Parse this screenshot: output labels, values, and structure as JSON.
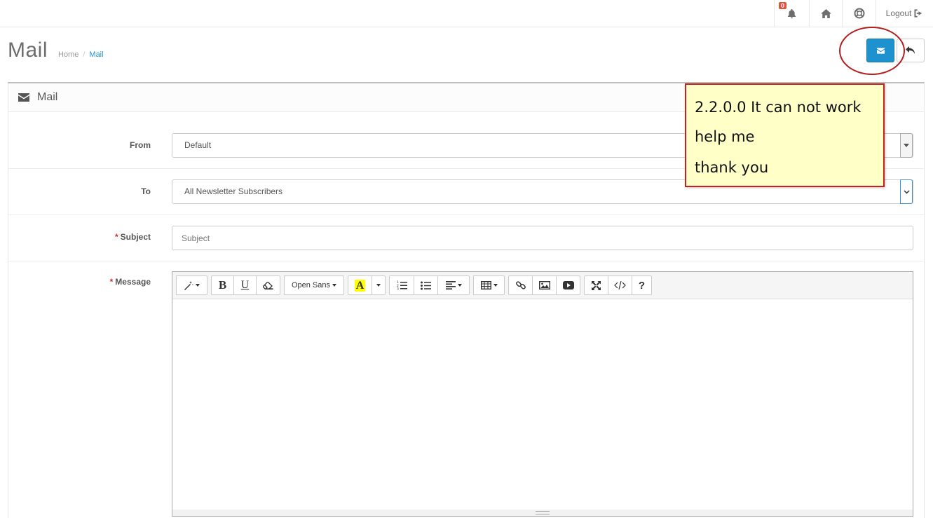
{
  "header": {
    "notification_count": "0",
    "logout_label": "Logout"
  },
  "page": {
    "title": "Mail",
    "breadcrumb": [
      "Home",
      "Mail"
    ]
  },
  "panel": {
    "title": "Mail"
  },
  "form": {
    "from": {
      "label": "From",
      "value": "Default"
    },
    "to": {
      "label": "To",
      "value": "All Newsletter Subscribers"
    },
    "subject": {
      "label": "Subject",
      "placeholder": "Subject",
      "value": ""
    },
    "message": {
      "label": "Message"
    }
  },
  "editor_toolbar": {
    "font_name": "Open Sans",
    "font_color_letter": "A",
    "bold": "B",
    "underline": "U",
    "help": "?"
  },
  "note": {
    "lines": [
      "2.2.0.0 It can not work",
      "help me",
      "thank you"
    ]
  },
  "colors": {
    "primary": "#1e91cf",
    "annotation_red": "#b31f1f",
    "note_bg": "#ffffc8",
    "required": "#cc2a2a",
    "badge": "#e3503e"
  },
  "icons": [
    "bell-icon",
    "home-icon",
    "life-ring-icon",
    "sign-out-icon",
    "envelope-icon",
    "reply-icon",
    "magic-icon",
    "eraser-icon",
    "ordered-list-icon",
    "unordered-list-icon",
    "align-icon",
    "table-icon",
    "link-icon",
    "picture-icon",
    "video-icon",
    "fullscreen-icon",
    "code-icon"
  ]
}
